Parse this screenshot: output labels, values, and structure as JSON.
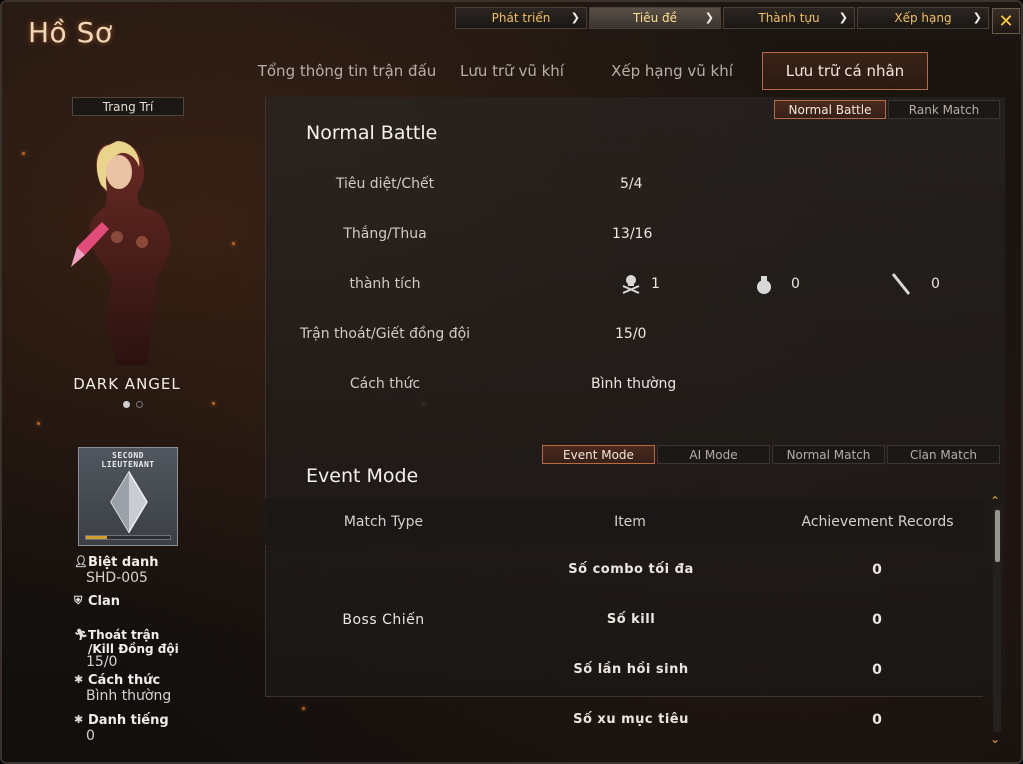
{
  "window": {
    "title": "Hồ Sơ",
    "close_label": "✕"
  },
  "top_nav": [
    {
      "label": "Phát triển",
      "active": false
    },
    {
      "label": "Tiêu đề",
      "active": true
    },
    {
      "label": "Thành tựu",
      "active": false
    },
    {
      "label": "Xếp hạng",
      "active": false
    }
  ],
  "main_tabs": [
    {
      "label": "Tổng thông tin trận đấu",
      "active": false
    },
    {
      "label": "Lưu trữ vũ khí",
      "active": false
    },
    {
      "label": "Xếp hạng vũ khí",
      "active": false
    },
    {
      "label": "Lưu trữ cá nhân",
      "active": true
    }
  ],
  "left_panel": {
    "decor_button": "Trang Trí",
    "character_name": "DARK ANGEL",
    "carousel": {
      "count": 2,
      "current": 1
    },
    "rank": {
      "title_line1": "SECOND",
      "title_line2": "LIEUTENANT",
      "progress": 0.25
    },
    "nickname_label": "Biệt danh",
    "nickname_value": "SHD-005",
    "clan_label": "Clan",
    "escape_label": "Thoát trận /Kill Đồng đội",
    "escape_value": "15/0",
    "style_label": "Cách thức",
    "style_value": "Bình thường",
    "fame_label": "Danh tiếng",
    "fame_value": "0"
  },
  "battle_mode_toggle": [
    {
      "label": "Normal Battle",
      "active": true
    },
    {
      "label": "Rank Match",
      "active": false
    }
  ],
  "normal_battle": {
    "title": "Normal Battle",
    "stats": [
      {
        "label": "Tiêu diệt/Chết",
        "value": "5/4"
      },
      {
        "label": "Thắng/Thua",
        "value": "13/16"
      },
      {
        "label": "thành tích",
        "value": ""
      },
      {
        "label": "Trận thoát/Giết đồng đội",
        "value": "15/0"
      },
      {
        "label": "Cách thức",
        "value": "Bình thường"
      }
    ],
    "achievements": [
      {
        "icon": "skull-crossbones-icon",
        "value": "1"
      },
      {
        "icon": "grenade-icon",
        "value": "0"
      },
      {
        "icon": "knife-icon",
        "value": "0"
      }
    ]
  },
  "event_mode": {
    "title": "Event Mode",
    "tabs": [
      {
        "label": "Event Mode",
        "active": true
      },
      {
        "label": "AI Mode",
        "active": false
      },
      {
        "label": "Normal Match",
        "active": false
      },
      {
        "label": "Clan Match",
        "active": false
      }
    ],
    "columns": [
      "Match Type",
      "Item",
      "Achievement Records"
    ],
    "group": "Boss Chiến",
    "rows": [
      {
        "item": "Số combo tối đa",
        "value": "0"
      },
      {
        "item": "Số kill",
        "value": "0"
      },
      {
        "item": "Số lần hồi sinh",
        "value": "0"
      },
      {
        "item": "Số xu mục tiêu",
        "value": "0"
      }
    ]
  },
  "colors": {
    "accent": "#b86b42",
    "gold": "#f0c060",
    "close": "#ffcf3a"
  }
}
